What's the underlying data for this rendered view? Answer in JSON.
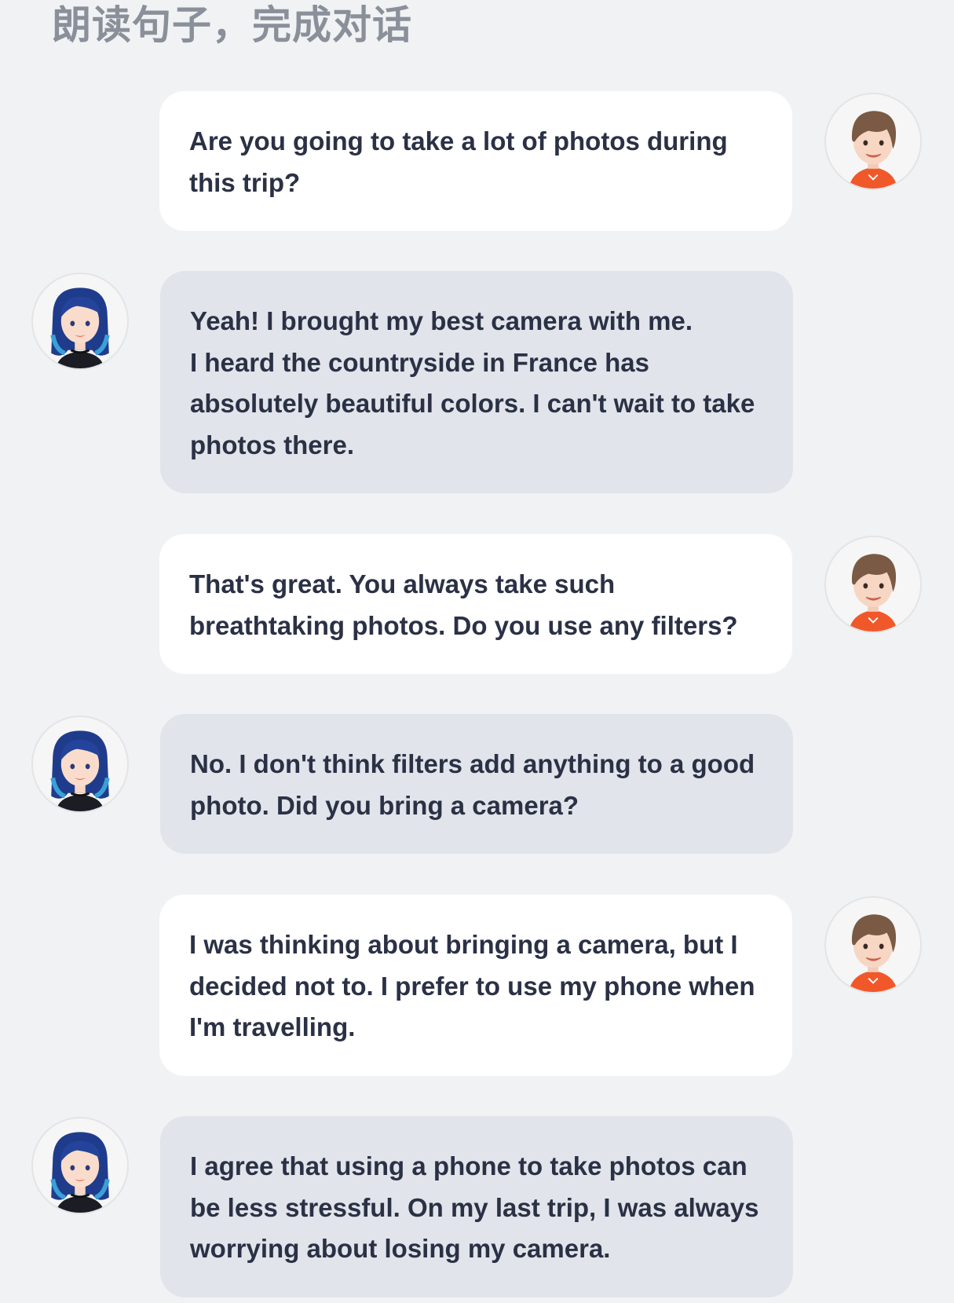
{
  "header": {
    "title": "朗读句子，完成对话"
  },
  "conversation": [
    {
      "speaker": "boy",
      "lines": [
        "Are you going to take a lot of photos during",
        "this trip?"
      ]
    },
    {
      "speaker": "girl",
      "lines": [
        "Yeah! I brought my best camera with me.",
        "I heard the countryside in France has",
        "absolutely beautiful colors. I can't wait to take",
        "photos there."
      ]
    },
    {
      "speaker": "boy",
      "lines": [
        "That's great. You always take such",
        "breathtaking photos. Do you use any filters?"
      ]
    },
    {
      "speaker": "girl",
      "lines": [
        "No. I don't think filters add anything to a good",
        "photo. Did you bring a camera?"
      ]
    },
    {
      "speaker": "boy",
      "lines": [
        "I was thinking about bringing a camera, but I",
        "decided not to. I prefer to use my phone when",
        "I'm travelling."
      ]
    },
    {
      "speaker": "girl",
      "lines": [
        "I agree that using a phone to take photos can",
        "be less stressful. On my last trip, I was always",
        "worrying about losing my camera."
      ]
    }
  ],
  "avatars": {
    "boy_icon": "boy-avatar-icon",
    "girl_icon": "girl-avatar-icon"
  },
  "colors": {
    "background": "#f1f2f4",
    "title_text": "#8a9099",
    "bubble_self": "#ffffff",
    "bubble_other": "#e1e4ea",
    "message_text": "#2b3145",
    "boy_hair": "#7a5a44",
    "boy_shirt": "#f0582a",
    "girl_hair": "#1f3c8c"
  }
}
